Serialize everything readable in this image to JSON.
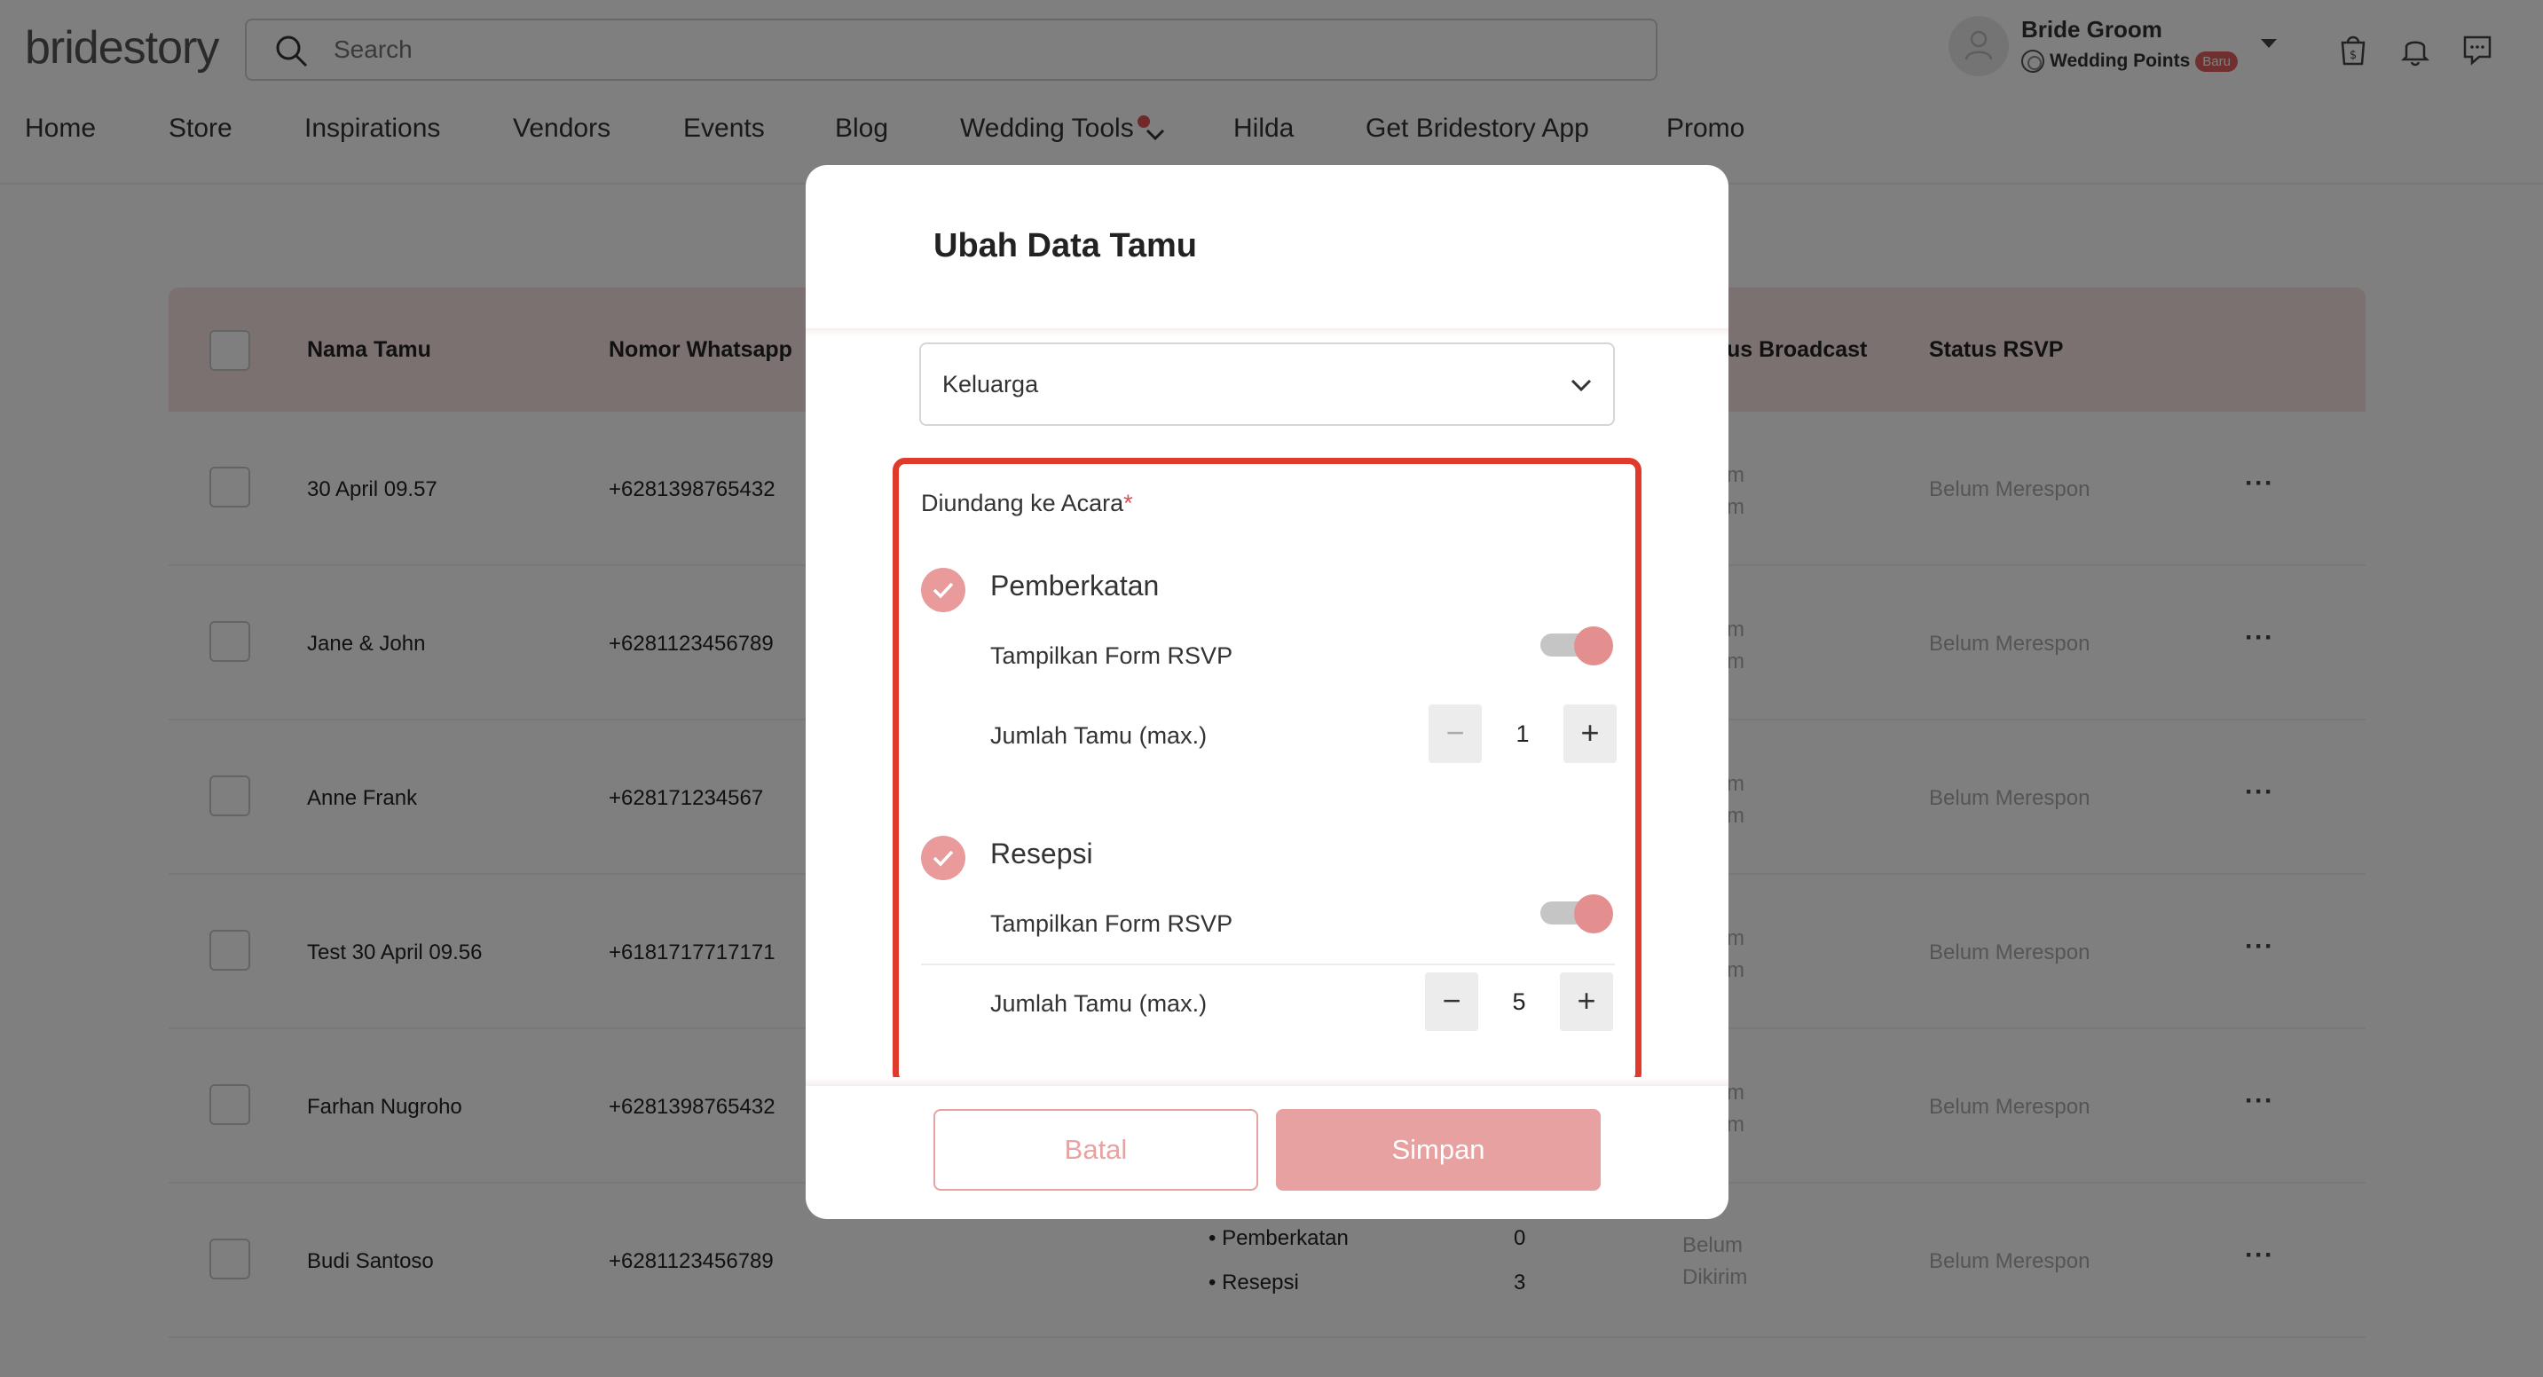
{
  "header": {
    "logo": "bridestory",
    "search_placeholder": "Search",
    "user_name": "Bride Groom",
    "points_label": "Wedding Points",
    "points_badge": "Baru"
  },
  "nav": {
    "items": [
      "Home",
      "Store",
      "Inspirations",
      "Vendors",
      "Events",
      "Blog",
      "Wedding Tools",
      "Hilda",
      "Get Bridestory App",
      "Promo"
    ]
  },
  "table": {
    "headers": [
      "Nama Tamu",
      "Nomor Whatsapp",
      "us Broadcast",
      "Status RSVP"
    ],
    "rows": [
      {
        "name": "30 April 09.57",
        "phone": "+6281398765432",
        "broadcast": [
          "m",
          "m"
        ],
        "rsvp": "Belum Merespon"
      },
      {
        "name": "Jane & John",
        "phone": "+6281123456789",
        "broadcast": [
          "m",
          "m"
        ],
        "rsvp": "Belum Merespon"
      },
      {
        "name": "Anne Frank",
        "phone": "+628171234567",
        "broadcast": [
          "m",
          "m"
        ],
        "rsvp": "Belum Merespon"
      },
      {
        "name": "Test 30 April 09.56",
        "phone": "+6181717717171",
        "broadcast": [
          "m",
          "m"
        ],
        "rsvp": "Belum Merespon"
      },
      {
        "name": "Farhan Nugroho",
        "phone": "+6281398765432",
        "broadcast": [
          "m",
          "m"
        ],
        "rsvp": "Belum Merespon"
      },
      {
        "name": "Budi Santoso",
        "phone": "+6281123456789",
        "broadcast": [
          "Belum",
          "Dikirim"
        ],
        "rsvp": "Belum Merespon",
        "events": [
          {
            "label": "• Pemberkatan",
            "count": "0"
          },
          {
            "label": "• Resepsi",
            "count": "3"
          }
        ]
      }
    ]
  },
  "modal": {
    "title": "Ubah Data Tamu",
    "group_value": "Keluarga",
    "invited_label": "Diundang ke Acara",
    "required_mark": "*",
    "events": [
      {
        "name": "Pemberkatan",
        "rsvp_label": "Tampilkan Form RSVP",
        "guests_label": "Jumlah Tamu (max.)",
        "guests": "1",
        "rsvp_on": true
      },
      {
        "name": "Resepsi",
        "rsvp_label": "Tampilkan Form RSVP",
        "guests_label": "Jumlah Tamu (max.)",
        "guests": "5",
        "rsvp_on": true
      }
    ],
    "cancel_label": "Batal",
    "save_label": "Simpan"
  },
  "colors": {
    "accent": "#e8a1a1",
    "highlight": "#e03a2c",
    "table_header": "#f4e3e1"
  }
}
